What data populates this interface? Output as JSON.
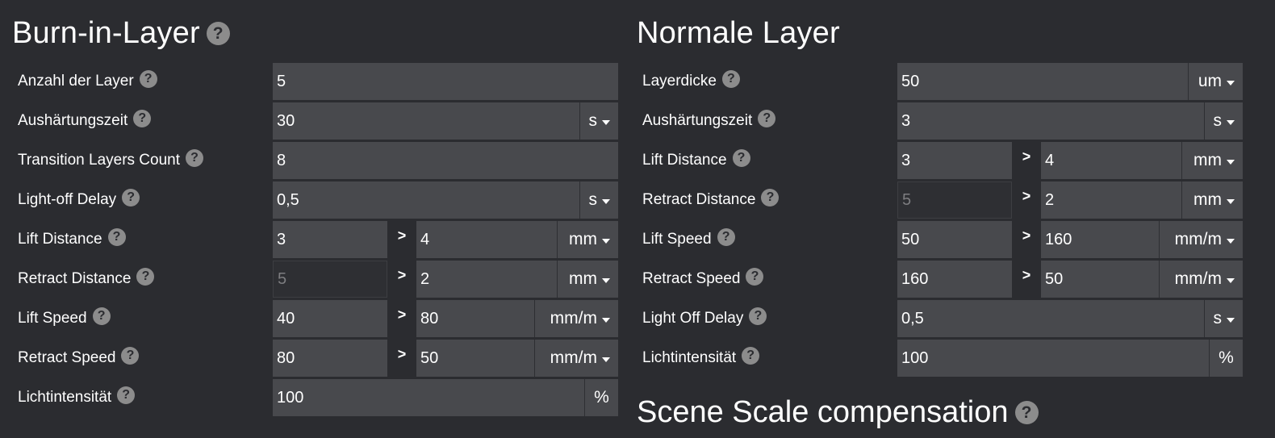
{
  "left": {
    "title": "Burn-in-Layer",
    "rows": {
      "layer_count": {
        "label": "Anzahl der Layer",
        "value": "5"
      },
      "cure_time": {
        "label": "Aushärtungszeit",
        "value": "30",
        "unit": "s"
      },
      "transition_layers": {
        "label": "Transition Layers Count",
        "value": "8"
      },
      "light_off_delay": {
        "label": "Light-off Delay",
        "value": "0,5",
        "unit": "s"
      },
      "lift_distance": {
        "label": "Lift Distance",
        "from": "3",
        "to": "4",
        "unit": "mm"
      },
      "retract_distance": {
        "label": "Retract Distance",
        "from": "5",
        "to": "2",
        "unit": "mm"
      },
      "lift_speed": {
        "label": "Lift Speed",
        "from": "40",
        "to": "80",
        "unit": "mm/m"
      },
      "retract_speed": {
        "label": "Retract Speed",
        "from": "80",
        "to": "50",
        "unit": "mm/m"
      },
      "light_intensity": {
        "label": "Lichtintensität",
        "value": "100",
        "unit": "%"
      }
    }
  },
  "right": {
    "title": "Normale Layer",
    "rows": {
      "layer_thickness": {
        "label": "Layerdicke",
        "value": "50",
        "unit": "um"
      },
      "cure_time": {
        "label": "Aushärtungszeit",
        "value": "3",
        "unit": "s"
      },
      "lift_distance": {
        "label": "Lift Distance",
        "from": "3",
        "to": "4",
        "unit": "mm"
      },
      "retract_distance": {
        "label": "Retract Distance",
        "from": "5",
        "to": "2",
        "unit": "mm"
      },
      "lift_speed": {
        "label": "Lift Speed",
        "from": "50",
        "to": "160",
        "unit": "mm/m"
      },
      "retract_speed": {
        "label": "Retract Speed",
        "from": "160",
        "to": "50",
        "unit": "mm/m"
      },
      "light_off_delay": {
        "label": "Light Off Delay",
        "value": "0,5",
        "unit": "s"
      },
      "light_intensity": {
        "label": "Lichtintensität",
        "value": "100",
        "unit": "%"
      }
    }
  },
  "scene_scale": {
    "title": "Scene Scale compensation"
  },
  "common": {
    "help_glyph": "?",
    "range_separator": ">"
  },
  "colors": {
    "background": "#2b2c30",
    "field": "#48494d",
    "help_icon": "#8c8c8c"
  }
}
